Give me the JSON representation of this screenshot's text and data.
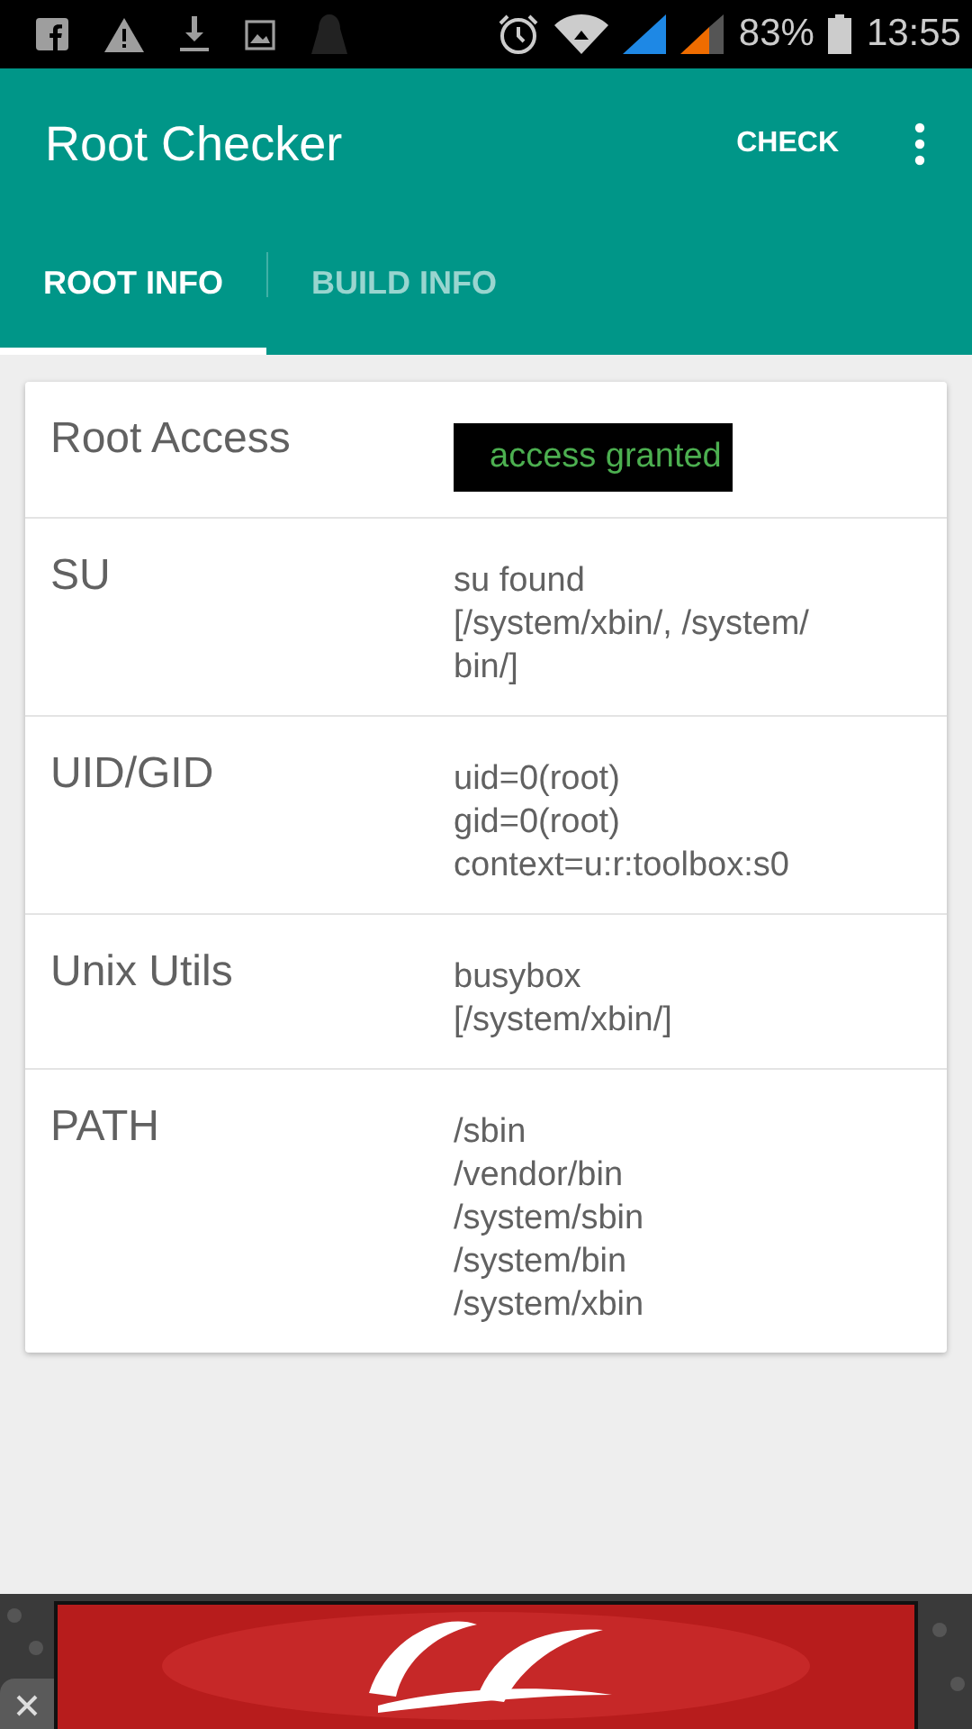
{
  "status_bar": {
    "battery_text": "83%",
    "time": "13:55"
  },
  "app_bar": {
    "title": "Root Checker",
    "action": "CHECK"
  },
  "tabs": [
    {
      "label": "ROOT INFO",
      "selected": true
    },
    {
      "label": "BUILD INFO",
      "selected": false
    }
  ],
  "rows": [
    {
      "label": "Root Access",
      "kind": "status",
      "lines": [
        "access granted"
      ]
    },
    {
      "label": "SU",
      "kind": "text",
      "lines": [
        "su found",
        "[/system/xbin/, /system/",
        "bin/]"
      ]
    },
    {
      "label": "UID/GID",
      "kind": "text",
      "lines": [
        "uid=0(root)",
        "gid=0(root)",
        "context=u:r:toolbox:s0"
      ]
    },
    {
      "label": "Unix Utils",
      "kind": "text",
      "lines": [
        "busybox",
        "[/system/xbin/]"
      ]
    },
    {
      "label": "PATH",
      "kind": "text",
      "lines": [
        "/sbin",
        "/vendor/bin",
        "/system/sbin",
        "/system/bin",
        "/system/xbin"
      ]
    }
  ]
}
